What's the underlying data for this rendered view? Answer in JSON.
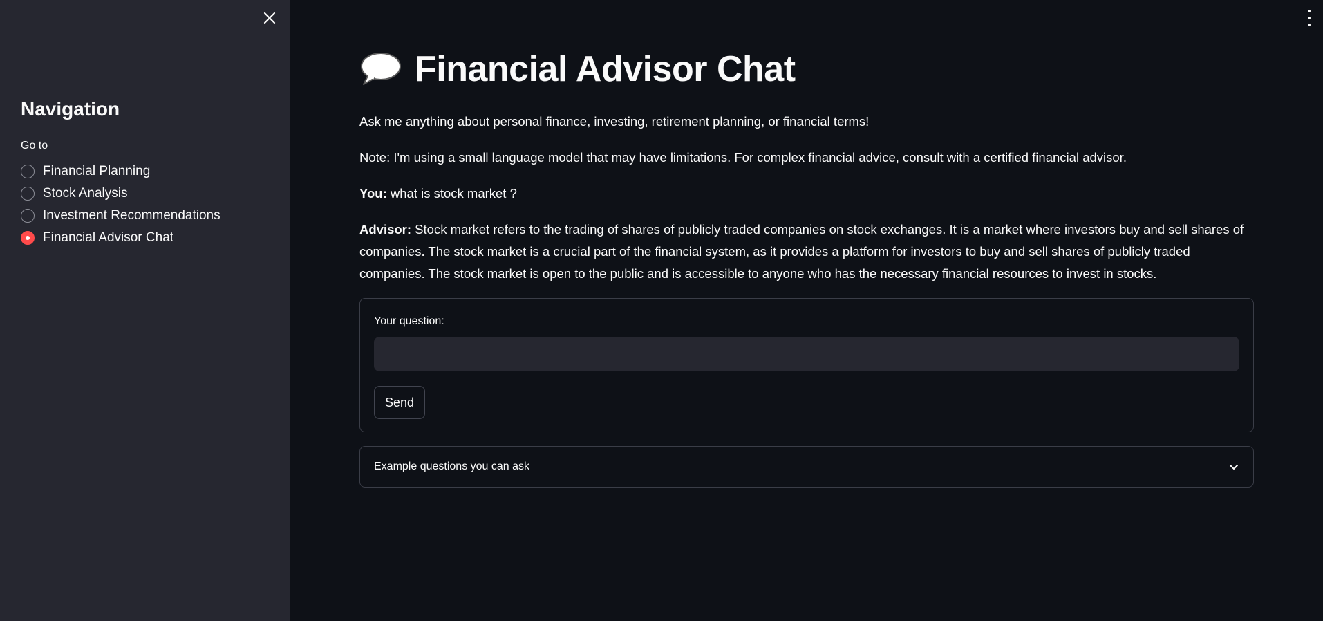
{
  "sidebar": {
    "title": "Navigation",
    "goto_label": "Go to",
    "options": [
      {
        "label": "Financial Planning",
        "selected": false
      },
      {
        "label": "Stock Analysis",
        "selected": false
      },
      {
        "label": "Investment Recommendations",
        "selected": false
      },
      {
        "label": "Financial Advisor Chat",
        "selected": true
      }
    ]
  },
  "main": {
    "title": "Financial Advisor Chat",
    "title_icon": "speech-bubble-icon",
    "intro": "Ask me anything about personal finance, investing, retirement planning, or financial terms!",
    "note": "Note: I'm using a small language model that may have limitations. For complex financial advice, consult with a certified financial advisor.",
    "chat": {
      "you_label": "You:",
      "you_text": " what is stock market ?",
      "advisor_label": "Advisor:",
      "advisor_text": " Stock market refers to the trading of shares of publicly traded companies on stock exchanges. It is a market where investors buy and sell shares of companies. The stock market is a crucial part of the financial system, as it provides a platform for investors to buy and sell shares of publicly traded companies. The stock market is open to the public and is accessible to anyone who has the necessary financial resources to invest in stocks."
    },
    "form": {
      "question_label": "Your question:",
      "question_value": "",
      "send_label": "Send"
    },
    "expander": {
      "label": "Example questions you can ask"
    }
  },
  "colors": {
    "accent": "#ff4b4b",
    "sidebar_bg": "#262730",
    "main_bg": "#0e1117"
  }
}
